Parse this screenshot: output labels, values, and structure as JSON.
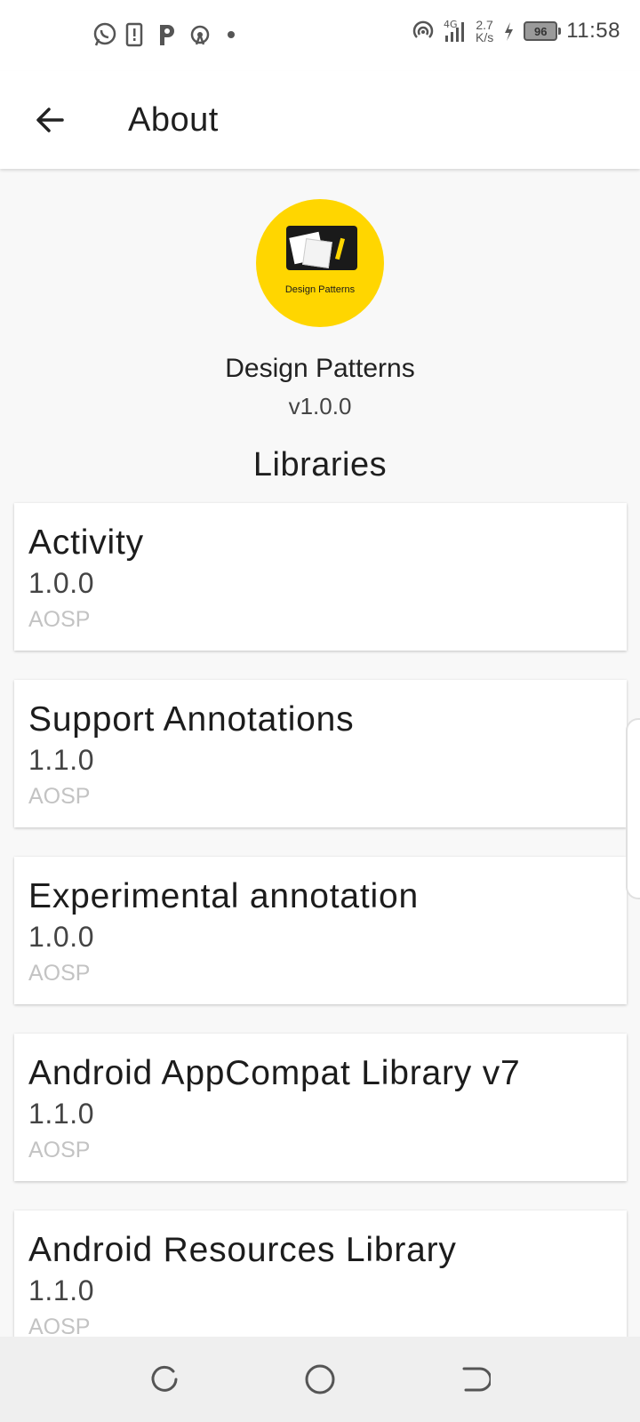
{
  "status_bar": {
    "net_speed_value": "2.7",
    "net_speed_unit": "K/s",
    "battery_level": "96",
    "time": "11:58",
    "left_icons": [
      "whatsapp-icon",
      "sim-alert-icon",
      "p-app-icon",
      "hotspot-icon",
      "more-dot-icon"
    ],
    "right_icons": [
      "hotspot-icon",
      "4g-signal-icon",
      "charging-icon",
      "battery-icon"
    ]
  },
  "app_bar": {
    "title": "About",
    "back_icon": "arrow-back-icon"
  },
  "app_info": {
    "logo_text": "Design Patterns",
    "name": "Design Patterns",
    "version": "v1.0.0",
    "logo_color": "#FFD600"
  },
  "libraries": {
    "title": "Libraries",
    "items": [
      {
        "name": "Activity",
        "version": "1.0.0",
        "license": "AOSP"
      },
      {
        "name": "Support Annotations",
        "version": "1.1.0",
        "license": "AOSP"
      },
      {
        "name": "Experimental annotation",
        "version": "1.0.0",
        "license": "AOSP"
      },
      {
        "name": "Android AppCompat Library v7",
        "version": "1.1.0",
        "license": "AOSP"
      },
      {
        "name": "Android Resources Library",
        "version": "1.1.0",
        "license": "AOSP"
      }
    ]
  },
  "nav_bar": {
    "buttons": [
      "recent-apps-icon",
      "home-icon",
      "back-icon"
    ]
  }
}
